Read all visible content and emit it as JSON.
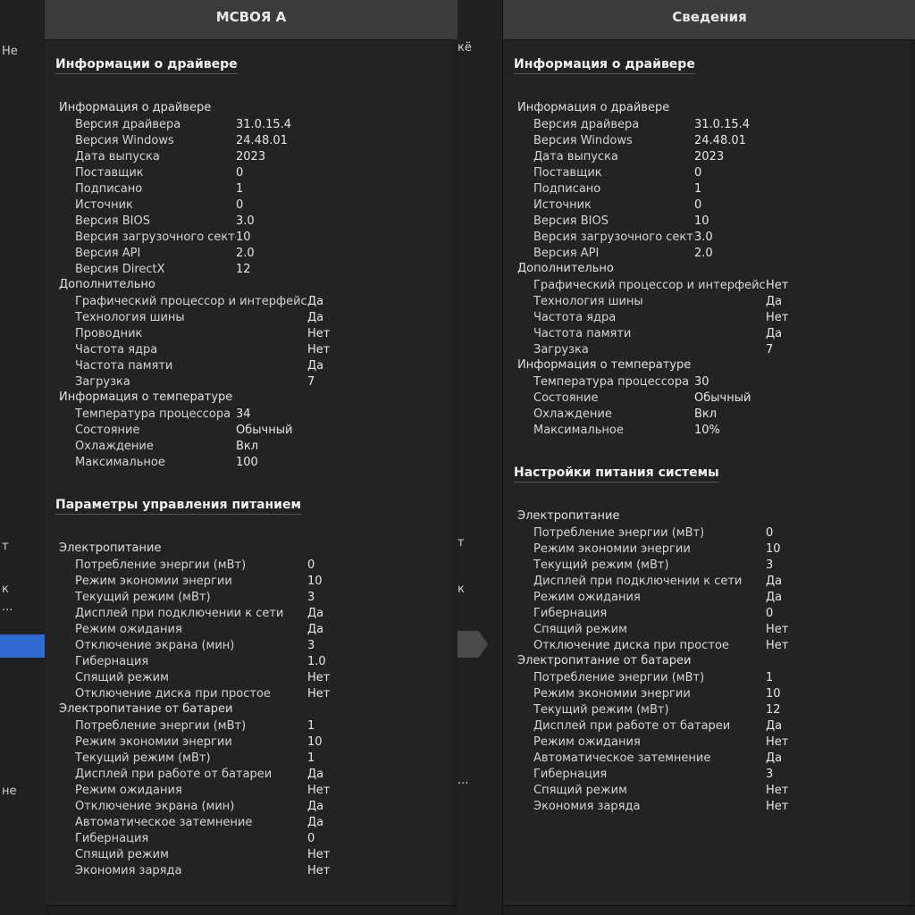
{
  "left_window": {
    "title": "МСВОЯ А",
    "section1_title": "Информации о драйвере",
    "driver_group": "Информация о драйвере",
    "driver_rows": [
      {
        "k": "Версия драйвера",
        "v": "31.0.15.4"
      },
      {
        "k": "Версия Windows",
        "v": "24.48.01"
      },
      {
        "k": "Дата выпуска",
        "v": "2023"
      },
      {
        "k": "Поставщик",
        "v": "0"
      },
      {
        "k": "Подписано",
        "v": "1"
      },
      {
        "k": "Источник",
        "v": "0"
      },
      {
        "k": "Версия BIOS",
        "v": "3.0"
      },
      {
        "k": "Версия загрузочного сектора",
        "v": "10"
      },
      {
        "k": "Версия API",
        "v": "2.0"
      },
      {
        "k": "Версия DirectX",
        "v": "12"
      }
    ],
    "extra_group": "Дополнительно",
    "extra_rows": [
      {
        "k": "Графический процессор и интерфейс",
        "v": "Да"
      },
      {
        "k": "Технология шины",
        "v": "Да"
      },
      {
        "k": "Проводник",
        "v": "Нет"
      },
      {
        "k": "Частота ядра",
        "v": "Нет"
      },
      {
        "k": "Частота памяти",
        "v": "Да"
      },
      {
        "k": "Загрузка",
        "v": "7"
      }
    ],
    "temp_group": "Информация о температуре",
    "temp_rows": [
      {
        "k": "Температура процессора",
        "v": "34"
      },
      {
        "k": "Состояние",
        "v": "Обычный"
      },
      {
        "k": "Охлаждение",
        "v": "Вкл"
      },
      {
        "k": "Максимальное",
        "v": "100"
      }
    ],
    "section2_title": "Параметры управления питанием",
    "plan1_group": "Электропитание",
    "plan1_rows": [
      {
        "k": "Потребление энергии (мВт)",
        "v": "0"
      },
      {
        "k": "Режим экономии энергии",
        "v": "10"
      },
      {
        "k": "Текущий режим (мВт)",
        "v": "3"
      },
      {
        "k": "Дисплей при подключении к сети",
        "v": "Да"
      },
      {
        "k": "Режим ожидания",
        "v": "Да"
      },
      {
        "k": "Отключение экрана (мин)",
        "v": "3"
      },
      {
        "k": "Гибернация",
        "v": "1.0"
      },
      {
        "k": "Спящий режим",
        "v": "Нет"
      },
      {
        "k": "Отключение диска при простое",
        "v": "Нет"
      }
    ],
    "plan2_group": "Электропитание от батареи",
    "plan2_rows": [
      {
        "k": "Потребление энергии (мВт)",
        "v": "1"
      },
      {
        "k": "Режим экономии энергии",
        "v": "10"
      },
      {
        "k": "Текущий режим (мВт)",
        "v": "1"
      },
      {
        "k": "Дисплей при работе от батареи",
        "v": "Да"
      },
      {
        "k": "Режим ожидания",
        "v": "Нет"
      },
      {
        "k": "Отключение экрана (мин)",
        "v": "Да"
      },
      {
        "k": "Автоматическое затемнение",
        "v": "Да"
      },
      {
        "k": "Гибернация",
        "v": "0"
      },
      {
        "k": "Спящий режим",
        "v": "Нет"
      },
      {
        "k": "Экономия заряда",
        "v": "Нет"
      }
    ]
  },
  "right_window": {
    "title": "Сведения",
    "section1_title": "Информация о драйвере",
    "driver_group": "Информация о драйвере",
    "driver_rows": [
      {
        "k": "Версия драйвера",
        "v": "31.0.15.4"
      },
      {
        "k": "Версия Windows",
        "v": "24.48.01"
      },
      {
        "k": "Дата выпуска",
        "v": "2023"
      },
      {
        "k": "Поставщик",
        "v": "0"
      },
      {
        "k": "Подписано",
        "v": "1"
      },
      {
        "k": "Источник",
        "v": "0"
      },
      {
        "k": "Версия BIOS",
        "v": "10"
      },
      {
        "k": "Версия загрузочного сектора",
        "v": "3.0"
      },
      {
        "k": "Версия API",
        "v": "2.0"
      }
    ],
    "extra_group": "Дополнительно",
    "extra_rows": [
      {
        "k": "Графический процессор и интерфейс",
        "v": "Нет"
      },
      {
        "k": "Технология шины",
        "v": "Да"
      },
      {
        "k": "Частота ядра",
        "v": "Нет"
      },
      {
        "k": "Частота памяти",
        "v": "Да"
      },
      {
        "k": "Загрузка",
        "v": "7"
      }
    ],
    "temp_group": "Информация о температуре",
    "temp_rows": [
      {
        "k": "Температура процессора",
        "v": "30"
      },
      {
        "k": "Состояние",
        "v": "Обычный"
      },
      {
        "k": "Охлаждение",
        "v": "Вкл"
      },
      {
        "k": "Максимальное",
        "v": "10%"
      }
    ],
    "section2_title": "Настройки питания системы",
    "plan1_group": "Электропитание",
    "plan1_rows": [
      {
        "k": "Потребление энергии (мВт)",
        "v": "0"
      },
      {
        "k": "Режим экономии энергии",
        "v": "10"
      },
      {
        "k": "Текущий режим (мВт)",
        "v": "3"
      },
      {
        "k": "Дисплей при подключении к сети",
        "v": "Да"
      },
      {
        "k": "Режим ожидания",
        "v": "Да"
      },
      {
        "k": "Гибернация",
        "v": "0"
      },
      {
        "k": "Спящий режим",
        "v": "Нет"
      },
      {
        "k": "Отключение диска при простое",
        "v": "Нет"
      }
    ],
    "plan2_group": "Электропитание от батареи",
    "plan2_rows": [
      {
        "k": "Потребление энергии (мВт)",
        "v": "1"
      },
      {
        "k": "Режим экономии энергии",
        "v": "10"
      },
      {
        "k": "Текущий режим (мВт)",
        "v": "12"
      },
      {
        "k": "Дисплей при работе от батареи",
        "v": "Да"
      },
      {
        "k": "Режим ожидания",
        "v": "Нет"
      },
      {
        "k": "Автоматическое затемнение",
        "v": "Да"
      },
      {
        "k": "Гибернация",
        "v": "3"
      },
      {
        "k": "Спящий режим",
        "v": "Нет"
      },
      {
        "k": "Экономия заряда",
        "v": "Нет"
      }
    ]
  },
  "left_strip": [
    "Не",
    "т",
    "к",
    "...",
    "не"
  ],
  "mid_strip": [
    "кё",
    "т",
    "к",
    "..."
  ]
}
